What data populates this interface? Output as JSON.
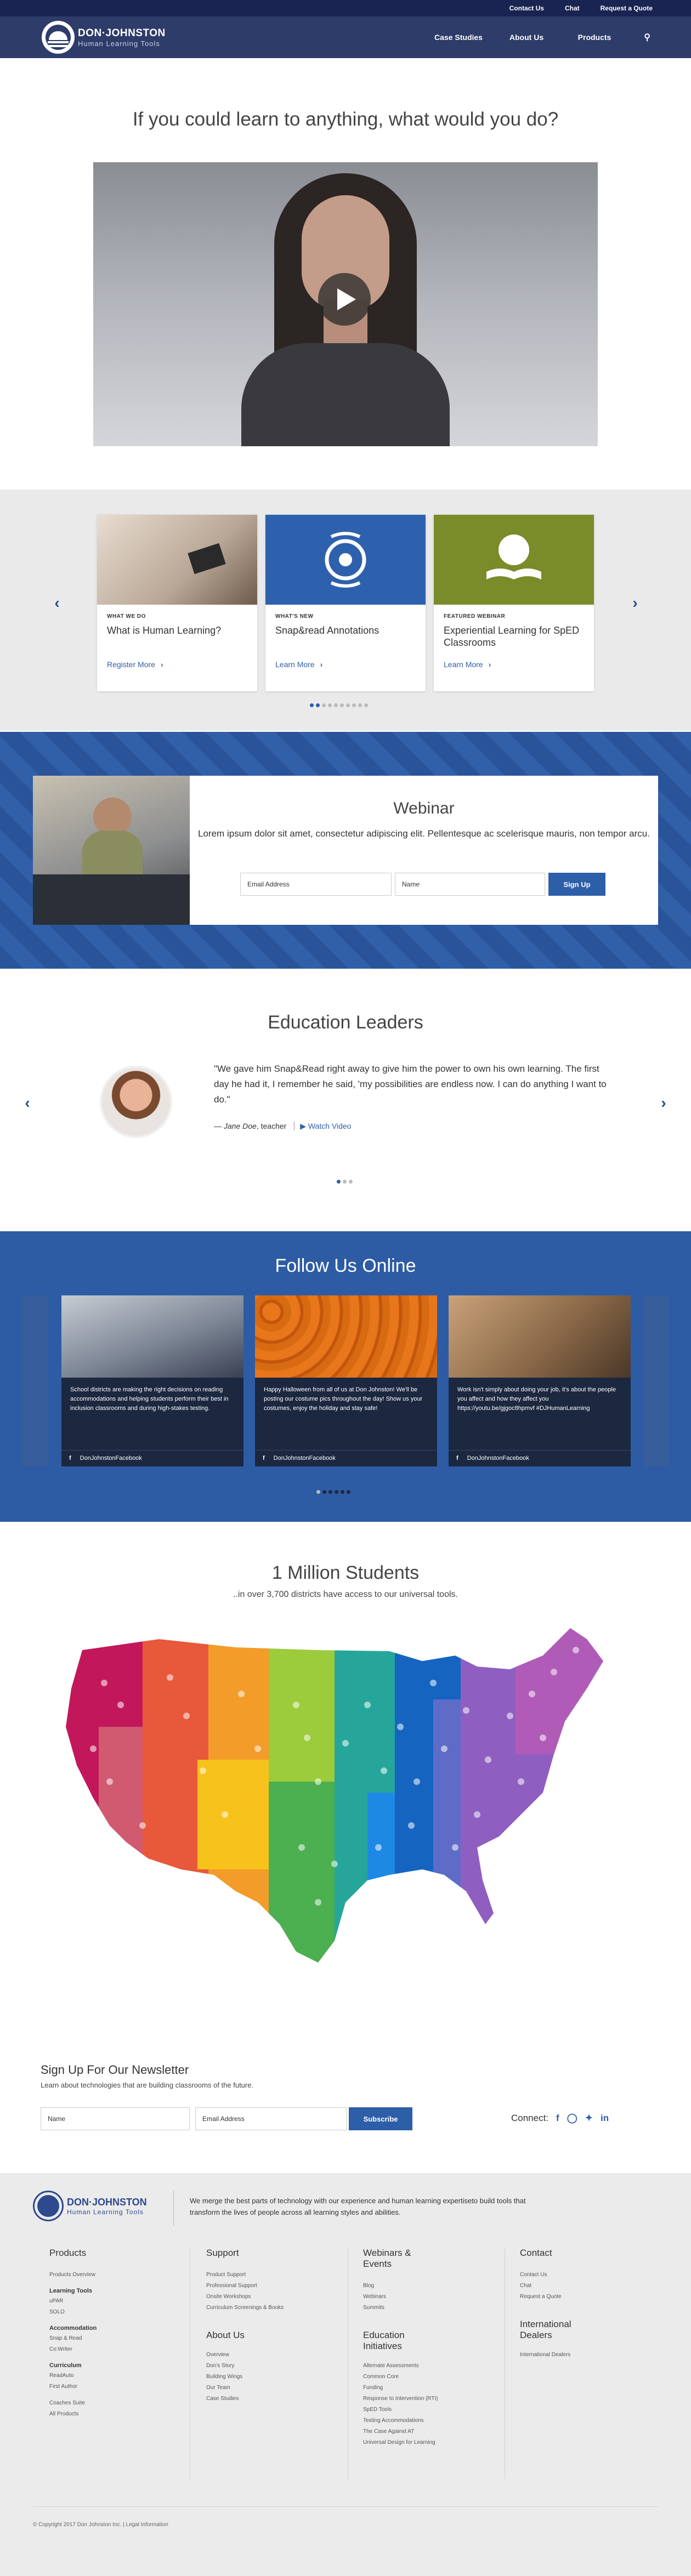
{
  "topbar": {
    "links": [
      "Contact Us",
      "Chat",
      "Request a Quote"
    ]
  },
  "logo": {
    "name": "DON·JOHNSTON",
    "tagline": "Human Learning Tools"
  },
  "nav": {
    "links": [
      "Case Studies",
      "About Us",
      "Products"
    ]
  },
  "hero": {
    "title": "If you could learn to anything, what would you do?"
  },
  "carousel": {
    "cards": [
      {
        "label": "WHAT WE DO",
        "title": "What is Human Learning?",
        "link": "Register More"
      },
      {
        "label": "WHAT'S NEW",
        "title": "Snap&read Annotations",
        "link": "Learn More"
      },
      {
        "label": "FEATURED WEBINAR",
        "title": "Experiential Learning for SpED Classrooms",
        "link": "Learn More"
      }
    ]
  },
  "webinar": {
    "title": "Webinar",
    "description": "Lorem ipsum dolor sit amet, consectetur adipiscing elit. Pellentesque ac scelerisque mauris, non tempor arcu.",
    "email_placeholder": "Email Address",
    "name_placeholder": "Name",
    "button": "Sign Up"
  },
  "education": {
    "title": "Education Leaders",
    "quote": "\"We gave him Snap&Read right away to give him the power to own his own learning. The first day he had it, I remember he said, 'my possibilities are endless now. I can do anything I want to do.\"",
    "dash": "—",
    "author": "Jane Doe",
    "role": ", teacher",
    "video_link": "Watch Video"
  },
  "follow": {
    "title": "Follow Us Online",
    "posts": [
      {
        "caption": "School districts are making the right decisions on reading accommodations and helping students perform their best in inclusion classrooms and during high-stakes testing.",
        "handle": "DonJohnstonFacebook"
      },
      {
        "caption": "Happy Halloween from all of us at Don Johnston! We'll be posting our costume pics throughout the day! Show us your costumes, enjoy the holiday and stay safe!",
        "handle": "DonJohnstonFacebook"
      },
      {
        "caption": "Work isn't simply about doing your job, it's about the people you affect and how they affect you https://youtu.be/gjgoc8hpmvf  #DJHumanLearning",
        "handle": "DonJohnstonFacebook"
      }
    ]
  },
  "students": {
    "title": "1 Million Students",
    "subtitle": "..in over 3,700 districts have access to our universal tools."
  },
  "newsletter": {
    "title": "Sign Up For Our Newsletter",
    "subtitle": "Learn about technologies that are building classrooms of the future.",
    "name_placeholder": "Name",
    "email_placeholder": "Email Address",
    "button": "Subscribe",
    "connect": "Connect:"
  },
  "footer": {
    "description": "We merge the best parts of technology with our experience and human learning expertiseto build tools that transform the lives of people across all learning styles and abilities.",
    "products": {
      "title": "Products",
      "overview": "Products Overview",
      "learning_tools": "Learning Tools",
      "lt_items": [
        "uPAR",
        "SOLO"
      ],
      "accommodation": "Accommodation",
      "acc_items": [
        "Snap & Read",
        "Co:Writer"
      ],
      "curriculum": "Curriculum",
      "cur_items": [
        "ReadAuto",
        "First Author"
      ],
      "extra": [
        "Coaches Suite",
        "All Products"
      ]
    },
    "support": {
      "title": "Support",
      "items": [
        "Product Support",
        "Professional Support",
        "Onsite Workshops",
        "Curriculum Screenings & Books"
      ]
    },
    "about": {
      "title": "About Us",
      "items": [
        "Overview",
        "Don's Story",
        "Building Wings",
        "Our Team",
        "Case Studies"
      ]
    },
    "webinars": {
      "title": "Webinars & Events",
      "items": [
        "Blog",
        "Webinars",
        "Summits"
      ]
    },
    "education": {
      "title": "Education Initiatives",
      "items": [
        "Alternate Assessments",
        "Common Core",
        "Funding",
        "Response to Intervention (RTI)",
        "SpED Tools",
        "Testing Accommodations",
        "The Case Against AT",
        "Universal Design for Learning"
      ]
    },
    "contact": {
      "title": "Contact",
      "items": [
        "Contact Us",
        "Chat",
        "Request a Quote"
      ]
    },
    "dealers": {
      "title": "International Dealers",
      "items": [
        "International Dealers"
      ]
    },
    "copyright": "© Copyright 2017 Don Johnston Inc.  |  Legal Information"
  }
}
